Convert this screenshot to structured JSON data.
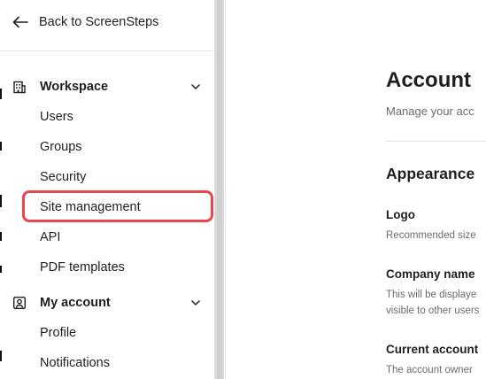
{
  "sidebar": {
    "back_label": "Back to ScreenSteps",
    "workspace": {
      "title": "Workspace",
      "items": [
        "Users",
        "Groups",
        "Security",
        "Site management",
        "API",
        "PDF templates"
      ]
    },
    "my_account": {
      "title": "My account",
      "items": [
        "Profile",
        "Notifications"
      ]
    },
    "highlighted_item": "Site management",
    "highlight_color": "#e8474f"
  },
  "main": {
    "title": "Account",
    "subtitle": "Manage your acc",
    "section_title": "Appearance",
    "fields": [
      {
        "label": "Logo",
        "help": [
          "Recommended size"
        ]
      },
      {
        "label": "Company name",
        "help": [
          "This will be displaye",
          "visible to other users"
        ]
      },
      {
        "label": "Current account",
        "help": [
          "The account owner"
        ]
      }
    ]
  }
}
